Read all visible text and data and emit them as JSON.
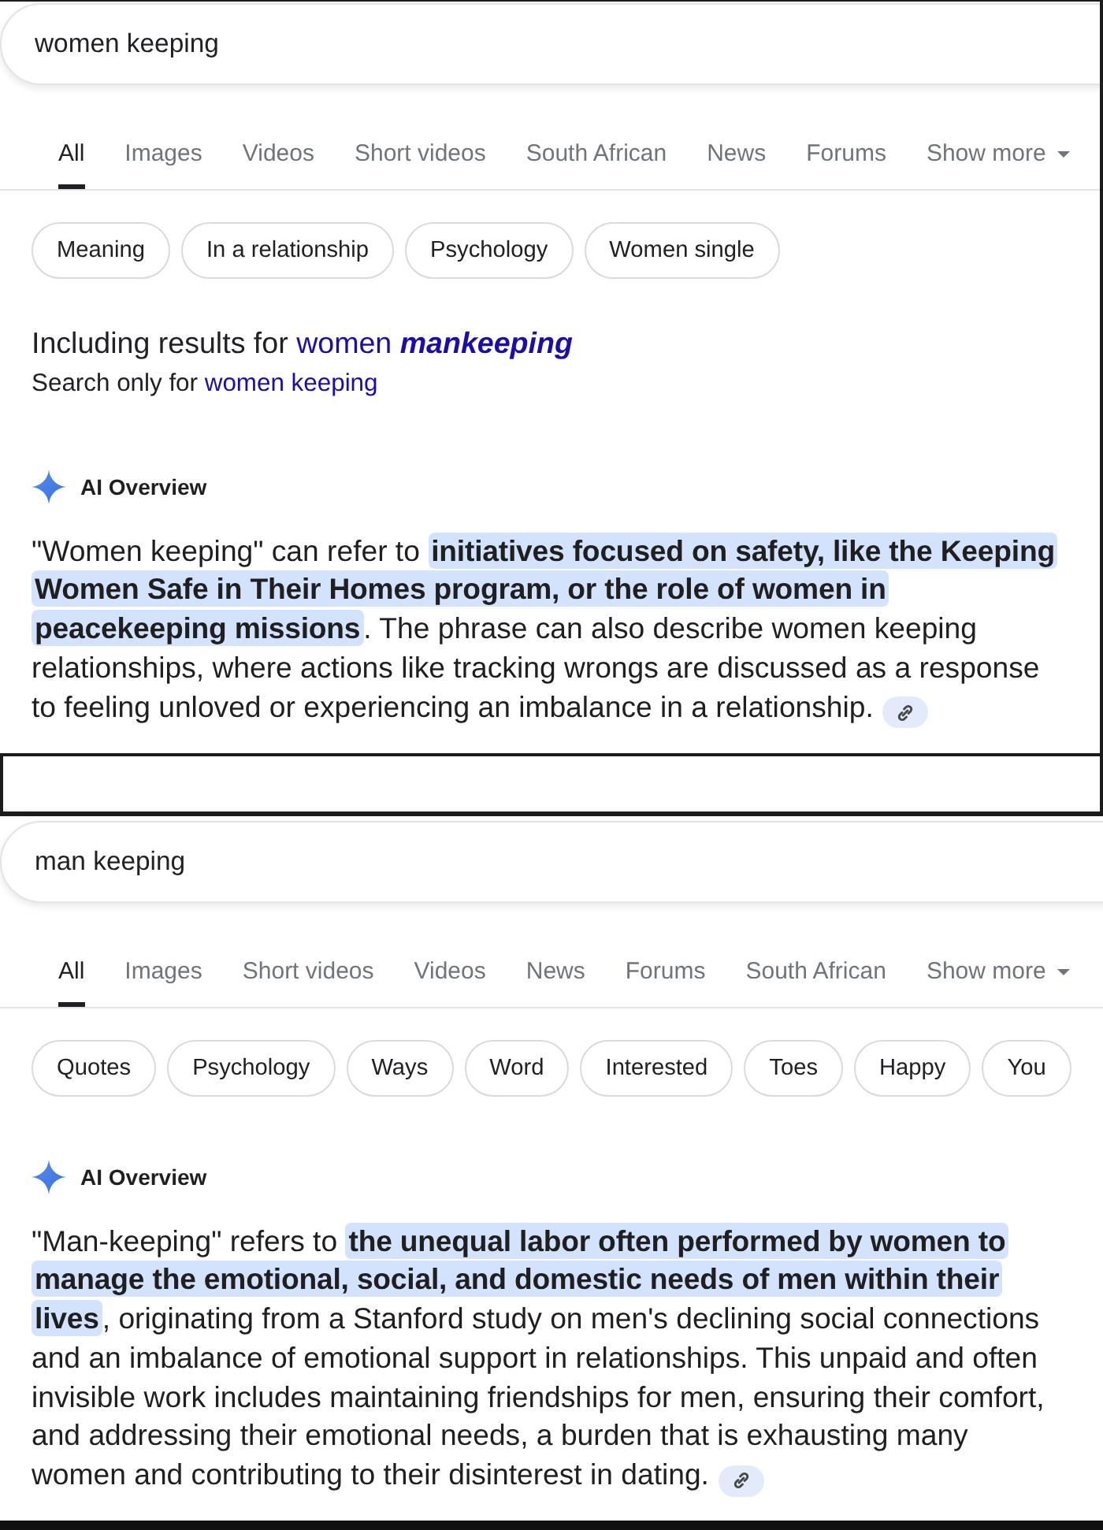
{
  "panels": [
    {
      "search": {
        "value": "women keeping"
      },
      "tabs": [
        {
          "label": "All",
          "selected": true,
          "kind": "tab"
        },
        {
          "label": "Images",
          "selected": false,
          "kind": "tab"
        },
        {
          "label": "Videos",
          "selected": false,
          "kind": "tab"
        },
        {
          "label": "Short videos",
          "selected": false,
          "kind": "tab"
        },
        {
          "label": "South African",
          "selected": false,
          "kind": "tab"
        },
        {
          "label": "News",
          "selected": false,
          "kind": "tab"
        },
        {
          "label": "Forums",
          "selected": false,
          "kind": "tab"
        },
        {
          "label": "Show more",
          "selected": false,
          "kind": "menu"
        }
      ],
      "chips": [
        "Meaning",
        "In a relationship",
        "Psychology",
        "Women single"
      ],
      "spelling": {
        "including_label": "Including results for",
        "including_link": "women **mankeeping**",
        "search_only_label": "Search only for",
        "search_only_link": "women keeping"
      },
      "ai_overview": {
        "heading": "AI Overview",
        "text": "\"Women keeping\" can refer to **initiatives focused on safety, like the Keeping Women Safe in Their Homes program, or the role of women in peacekeeping missions**. The phrase can also describe women keeping relationships, where actions like tracking wrongs are discussed as a response to feeling unloved or experiencing an imbalance in a relationship."
      }
    },
    {
      "search": {
        "value": "man keeping"
      },
      "tabs": [
        {
          "label": "All",
          "selected": true,
          "kind": "tab"
        },
        {
          "label": "Images",
          "selected": false,
          "kind": "tab"
        },
        {
          "label": "Short videos",
          "selected": false,
          "kind": "tab"
        },
        {
          "label": "Videos",
          "selected": false,
          "kind": "tab"
        },
        {
          "label": "News",
          "selected": false,
          "kind": "tab"
        },
        {
          "label": "Forums",
          "selected": false,
          "kind": "tab"
        },
        {
          "label": "South African",
          "selected": false,
          "kind": "tab"
        },
        {
          "label": "Show more",
          "selected": false,
          "kind": "menu"
        }
      ],
      "chips": [
        "Quotes",
        "Psychology",
        "Ways",
        "Word",
        "Interested",
        "Toes",
        "Happy",
        "You"
      ],
      "ai_overview": {
        "heading": "AI Overview",
        "text": "\"Man-keeping\" refers to **the unequal labor often performed by women to manage the emotional, social, and domestic needs of men within their lives**, originating from a Stanford study on men's declining social connections and an imbalance of emotional support in relationships. This unpaid and often invisible work includes maintaining friendships for men, ensuring their comfort, and addressing their emotional needs, a burden that is exhausting many women and contributing to their disinterest in dating."
      }
    }
  ]
}
